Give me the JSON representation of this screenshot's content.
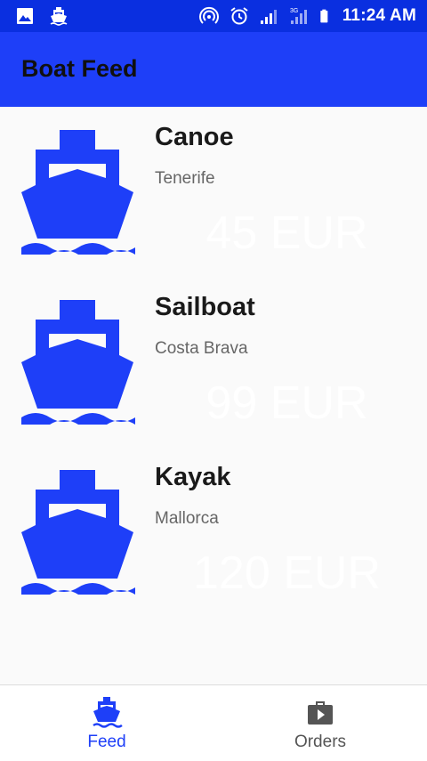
{
  "status_bar": {
    "time": "11:24 AM",
    "icons": [
      "image-icon",
      "boat-icon",
      "hotspot-icon",
      "alarm-icon",
      "signal-icon",
      "3g-signal-icon",
      "battery-icon"
    ]
  },
  "app_bar": {
    "title": "Boat Feed"
  },
  "feed": {
    "items": [
      {
        "name": "Canoe",
        "location": "Tenerife",
        "price": "45 EUR"
      },
      {
        "name": "Sailboat",
        "location": "Costa Brava",
        "price": "99 EUR"
      },
      {
        "name": "Kayak",
        "location": "Mallorca",
        "price": "120 EUR"
      }
    ]
  },
  "bottom_nav": {
    "tabs": [
      {
        "label": "Feed",
        "icon": "boat-icon",
        "active": true
      },
      {
        "label": "Orders",
        "icon": "briefcase-play-icon",
        "active": false
      }
    ]
  },
  "colors": {
    "status_bar": "#0a2fe0",
    "app_bar": "#1e3ff8",
    "accent": "#1e3ff8",
    "inactive": "#555555"
  }
}
